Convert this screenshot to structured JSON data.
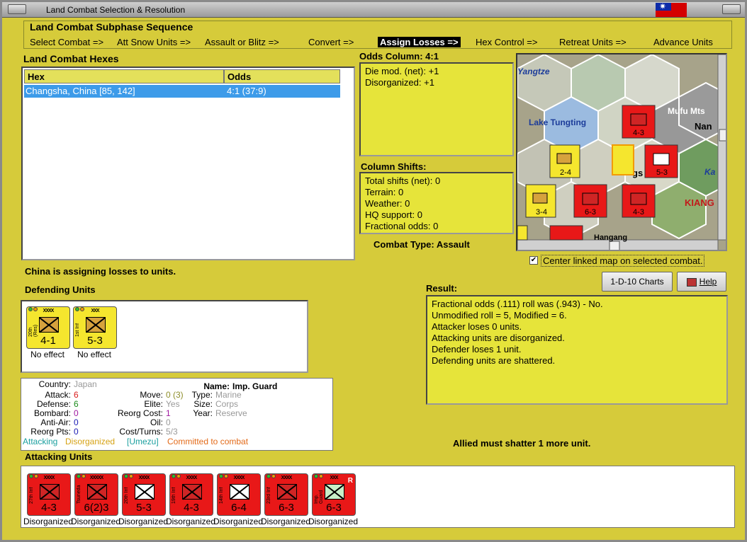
{
  "window": {
    "title": "Land Combat Selection & Resolution"
  },
  "phase": {
    "header": "Land Combat Subphase Sequence",
    "steps": [
      "Select Combat =>",
      "Att Snow Units =>",
      "Assault or Blitz =>",
      "Convert =>",
      "Assign Losses =>",
      "Hex Control =>",
      "Retreat Units =>",
      "Advance Units"
    ],
    "active_index": 4
  },
  "hexes": {
    "title": "Land Combat Hexes",
    "columns": [
      "Hex",
      "Odds"
    ],
    "rows": [
      [
        "Changsha, China [85, 142]",
        "4:1 (37:9)"
      ]
    ]
  },
  "odds": {
    "title": "Odds Column: 4:1",
    "lines": [
      "Die mod. (net): +1",
      "Disorganized: +1"
    ]
  },
  "shifts": {
    "title": "Column Shifts:",
    "lines": [
      "Total shifts (net): 0",
      "Terrain: 0",
      "Weather: 0",
      "HQ support: 0",
      "Fractional odds: 0"
    ]
  },
  "combat_type": "Combat Type:  Assault",
  "map": {
    "labels": [
      "Yangtze",
      "Lake Tungting",
      "Mufu Mts",
      "Nan",
      "Ka",
      "KIANG",
      "gs",
      "Hangang"
    ],
    "center_checkbox": "Center linked map on selected combat.",
    "center_checked": true
  },
  "status_msg": "China is assigning losses to units.",
  "defending": {
    "title": "Defending Units",
    "units": [
      {
        "name": "20th (Res)",
        "size": "XXXX",
        "value": "4-1",
        "status": "No effect",
        "color": "yellow",
        "sym": "hq"
      },
      {
        "name": "1st Inf",
        "size": "XXX",
        "value": "5-3",
        "status": "No effect",
        "color": "yellow",
        "sym": "inf"
      }
    ]
  },
  "buttons": {
    "charts": "1-D-10 Charts",
    "help": "Help"
  },
  "result": {
    "title": "Result:",
    "lines": [
      "Fractional odds (.111) roll was (.943)  - No.",
      "Unmodified roll = 5, Modified = 6.",
      "Attacker loses 0 units.",
      "Attacking units are disorganized.",
      "Defender loses 1 unit.",
      "Defending units are shattered."
    ]
  },
  "info": {
    "country_label": "Country:",
    "country": "Japan",
    "name_label": "Name:",
    "name": "Imp. Guard",
    "attack_label": "Attack:",
    "attack": "6",
    "defense_label": "Defense:",
    "defense": "6",
    "bombard_label": "Bombard:",
    "bombard": "0",
    "antiair_label": "Anti-Air:",
    "antiair": "0",
    "reorg_pts_label": "Reorg Pts:",
    "reorg_pts": "0",
    "move_label": "Move:",
    "move": "0 (3)",
    "elite_label": "Elite:",
    "elite": "Yes",
    "reorg_cost_label": "Reorg Cost:",
    "reorg_cost": "1",
    "oil_label": "Oil:",
    "oil": "0",
    "cost_turns_label": "Cost/Turns:",
    "cost_turns": "5/3",
    "type_label": "Type:",
    "type": "Marine",
    "size_label": "Size:",
    "size": "Corps",
    "year_label": "Year:",
    "year": "Reserve",
    "tags": [
      "Attacking",
      "Disorganized",
      "[Umezu]",
      "Committed to combat"
    ]
  },
  "allied_msg": "Allied must shatter 1 more unit.",
  "attacking": {
    "title": "Attacking Units",
    "units": [
      {
        "name": "27th Inf",
        "size": "XXXX",
        "value": "4-3",
        "status": "Disorganized",
        "sym": "inf"
      },
      {
        "name": "Tsuneda",
        "size": "XXXXX",
        "value": "6(2)3",
        "status": "Disorganized",
        "sym": "inf"
      },
      {
        "name": "20th Inf",
        "size": "XXXX",
        "value": "5-3",
        "status": "Disorganized",
        "sym": "white"
      },
      {
        "name": "19th Inf",
        "size": "XXXX",
        "value": "4-3",
        "status": "Disorganized",
        "sym": "inf"
      },
      {
        "name": "14th Inf",
        "size": "XXXX",
        "value": "6-4",
        "status": "Disorganized",
        "sym": "white"
      },
      {
        "name": "23rd Inf",
        "size": "XXXX",
        "value": "6-3",
        "status": "Disorganized",
        "sym": "inf"
      },
      {
        "name": "Imp. Guard",
        "size": "XXX",
        "value": "6-3",
        "status": "Disorganized",
        "sym": "marine",
        "badge": "R"
      }
    ]
  }
}
